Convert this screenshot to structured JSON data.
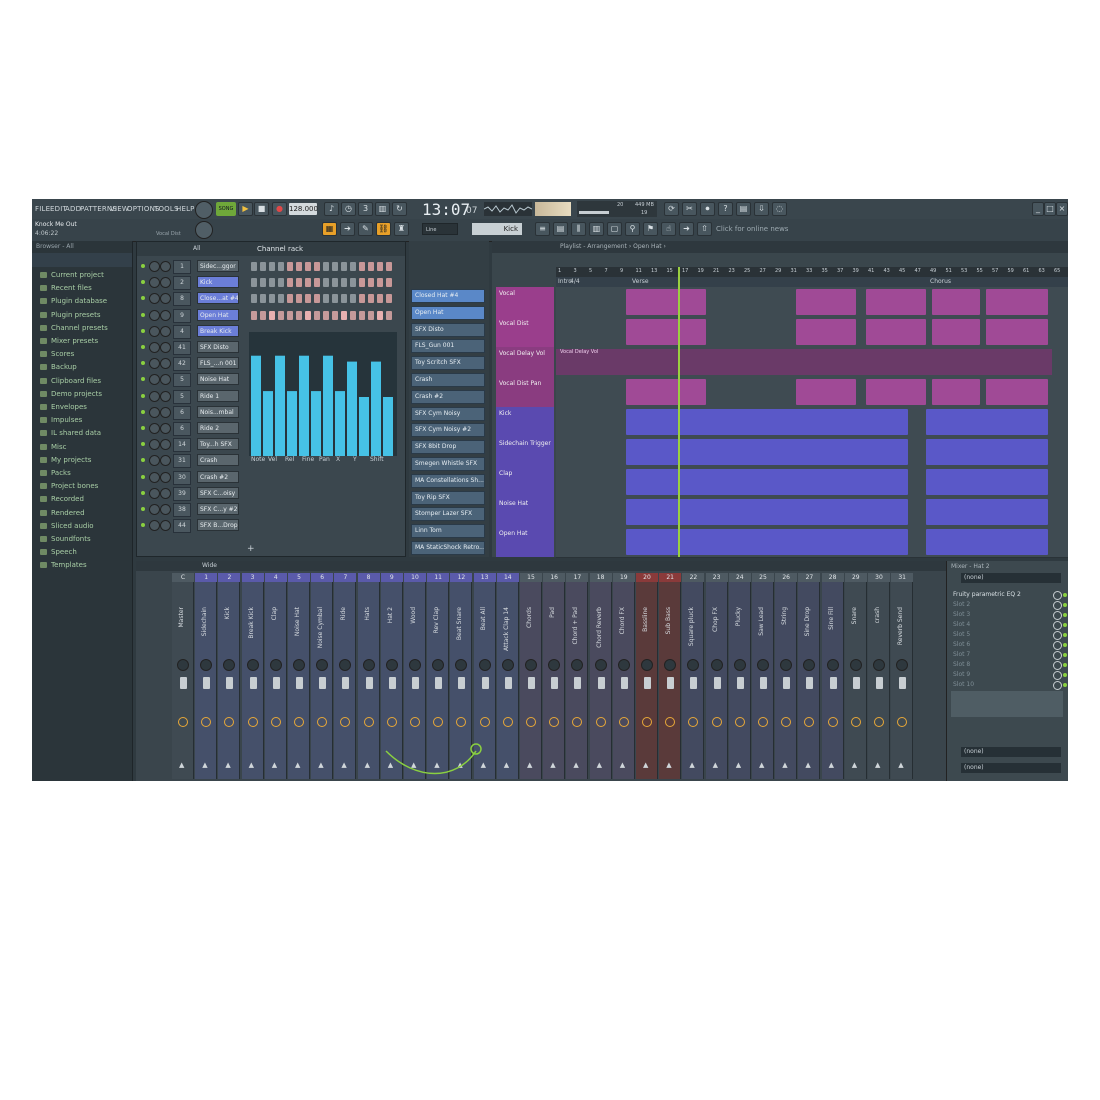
{
  "menu": [
    "FILE",
    "EDIT",
    "ADD",
    "PATTERNS",
    "VIEW",
    "OPTIONS",
    "TOOLS",
    "HELP"
  ],
  "transport": {
    "mode": "SONG",
    "tempo": "128.000",
    "time": "13:07",
    "time_sub": "07",
    "cpu": "20",
    "mem": "449 MB",
    "poly": "19"
  },
  "project": {
    "title": "Knock Me Out",
    "length": "4:06:22",
    "hint": "Vocal Dist"
  },
  "toolbar2": {
    "snap": "Line",
    "pattern": "Kick",
    "news": "Click for online news"
  },
  "browser": {
    "header": "Browser - All",
    "items": [
      "Current project",
      "Recent files",
      "Plugin database",
      "Plugin presets",
      "Channel presets",
      "Mixer presets",
      "Scores",
      "Backup",
      "Clipboard files",
      "Demo projects",
      "Envelopes",
      "Impulses",
      "IL shared data",
      "Misc",
      "My projects",
      "Packs",
      "Project bones",
      "Recorded",
      "Rendered",
      "Sliced audio",
      "Soundfonts",
      "Speech",
      "Templates"
    ]
  },
  "rack": {
    "filter": "All",
    "title": "Channel rack",
    "channels": [
      {
        "num": "1",
        "name": "Sidec...ggor"
      },
      {
        "num": "2",
        "name": "Kick"
      },
      {
        "num": "8",
        "name": "Close...at #4"
      },
      {
        "num": "9",
        "name": "Open Hat"
      },
      {
        "num": "4",
        "name": "Break Kick"
      },
      {
        "num": "41",
        "name": "SFX Disto"
      },
      {
        "num": "42",
        "name": "FLS_...n 001"
      },
      {
        "num": "5",
        "name": "Noise Hat"
      },
      {
        "num": "5",
        "name": "Ride 1"
      },
      {
        "num": "6",
        "name": "Nois...mbal"
      },
      {
        "num": "6",
        "name": "Ride 2"
      },
      {
        "num": "14",
        "name": "Toy...h SFX"
      },
      {
        "num": "31",
        "name": "Crash"
      },
      {
        "num": "30",
        "name": "Crash #2"
      },
      {
        "num": "39",
        "name": "SFX C...oisy"
      },
      {
        "num": "38",
        "name": "SFX C...y #2"
      },
      {
        "num": "44",
        "name": "SFX B...Drop"
      }
    ],
    "graph_tabs": [
      "Note",
      "Vel",
      "Rel",
      "Fine",
      "Pan",
      "X",
      "Y",
      "Shift"
    ],
    "add": "+"
  },
  "patterns": [
    "Closed Hat #4",
    "Open Hat",
    "SFX Disto",
    "FLS_Gun 001",
    "Toy Scritch SFX",
    "Crash",
    "Crash #2",
    "SFX Cym Noisy",
    "SFX Cym Noisy #2",
    "SFX 8bit Drop",
    "Smegen Whistle SFX",
    "MA Constellations Sh...",
    "Toy Rip SFX",
    "Stomper Lazer SFX",
    "Linn Tom",
    "MA StaticShock Retro..."
  ],
  "playlist": {
    "title": "Playlist - Arrangement › Open Hat ›",
    "markers": [
      "Intro",
      "Verse",
      "Chorus"
    ],
    "timesig": "4/4",
    "ruler": [
      "1",
      "3",
      "5",
      "7",
      "9",
      "11",
      "13",
      "15",
      "17",
      "19",
      "21",
      "23",
      "25",
      "27",
      "29",
      "31",
      "33",
      "35",
      "37",
      "39",
      "41",
      "43",
      "45",
      "47",
      "49",
      "51",
      "53",
      "55",
      "57",
      "59",
      "61",
      "63",
      "65"
    ],
    "tracks": [
      "Vocal",
      "Vocal Dist",
      "Vocal Delay Vol",
      "Vocal Dist Pan",
      "Kick",
      "Sidechain Trigger",
      "Clap",
      "Noise Hat",
      "Open Hat"
    ],
    "auto_clip": "Vocal Delay Vol"
  },
  "mixer": {
    "title": "Wide",
    "strips": [
      {
        "n": "C",
        "name": "Master"
      },
      {
        "n": "1",
        "name": "Sidechain"
      },
      {
        "n": "2",
        "name": "Kick"
      },
      {
        "n": "3",
        "name": "Break Kick"
      },
      {
        "n": "4",
        "name": "Clap"
      },
      {
        "n": "5",
        "name": "Noise Hat"
      },
      {
        "n": "6",
        "name": "Noise Cymbal"
      },
      {
        "n": "7",
        "name": "Ride"
      },
      {
        "n": "8",
        "name": "Hats"
      },
      {
        "n": "9",
        "name": "Hat 2"
      },
      {
        "n": "10",
        "name": "Wood"
      },
      {
        "n": "11",
        "name": "Rev Clap"
      },
      {
        "n": "12",
        "name": "Beat Snare"
      },
      {
        "n": "13",
        "name": "Beat All"
      },
      {
        "n": "14",
        "name": "Attack Clap 14"
      },
      {
        "n": "15",
        "name": "Chords"
      },
      {
        "n": "16",
        "name": "Pad"
      },
      {
        "n": "17",
        "name": "Chord + Pad"
      },
      {
        "n": "18",
        "name": "Chord Reverb"
      },
      {
        "n": "19",
        "name": "Chord FX"
      },
      {
        "n": "20",
        "name": "Bassline"
      },
      {
        "n": "21",
        "name": "Sub Bass"
      },
      {
        "n": "22",
        "name": "Square pluck"
      },
      {
        "n": "23",
        "name": "Chop FX"
      },
      {
        "n": "24",
        "name": "Plucky"
      },
      {
        "n": "25",
        "name": "Saw Lead"
      },
      {
        "n": "26",
        "name": "String"
      },
      {
        "n": "27",
        "name": "Sine Drop"
      },
      {
        "n": "28",
        "name": "Sine Fill"
      },
      {
        "n": "29",
        "name": "Snare"
      },
      {
        "n": "30",
        "name": "crash"
      },
      {
        "n": "31",
        "name": "Reverb Send"
      }
    ],
    "extra_num": "125"
  },
  "insert": {
    "title": "Mixer - Hat 2",
    "input": "(none)",
    "slots": [
      "Fruity parametric EQ 2",
      "Slot 2",
      "Slot 3",
      "Slot 4",
      "Slot 5",
      "Slot 6",
      "Slot 7",
      "Slot 8",
      "Slot 9",
      "Slot 10"
    ],
    "out1": "(none)",
    "out2": "(none)"
  }
}
